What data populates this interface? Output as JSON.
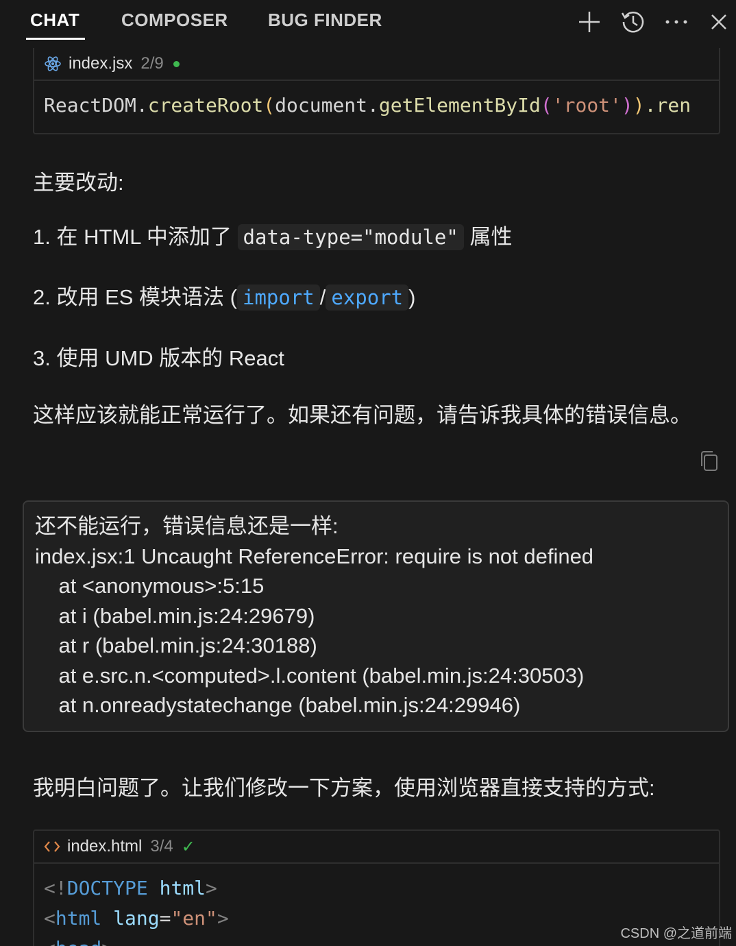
{
  "tabs": [
    {
      "label": "CHAT",
      "active": true
    },
    {
      "label": "COMPOSER",
      "active": false
    },
    {
      "label": "BUG FINDER",
      "active": false
    }
  ],
  "toolbar": {
    "icons": [
      "plus-icon",
      "history-icon",
      "more-icon",
      "close-icon"
    ]
  },
  "codeblock1": {
    "filename": "index.jsx",
    "count": "2/9",
    "status_dot_color": "#3fb950",
    "line": {
      "t1": "ReactDOM.",
      "t2": "createRoot",
      "t3": "(",
      "t4": "document.",
      "t5": "getElementById",
      "t6": "(",
      "t7": "'root'",
      "t8": ")",
      "t9": ")",
      "t10": ".ren"
    }
  },
  "assistant1": {
    "heading": "主要改动:",
    "item1_prefix": "1. 在 HTML 中添加了 ",
    "item1_code": "data-type=\"module\"",
    "item1_suffix": " 属性",
    "item2_prefix": "2. 改用 ES 模块语法 (",
    "item2_code1": "import",
    "item2_sep": "/",
    "item2_code2": "export",
    "item2_suffix": ")",
    "item3": "3. 使用 UMD 版本的 React",
    "closing": "这样应该就能正常运行了。如果还有问题，请告诉我具体的错误信息。"
  },
  "user_message": {
    "lines": [
      "还不能运行，错误信息还是一样:",
      "index.jsx:1 Uncaught ReferenceError: require is not defined",
      "    at <anonymous>:5:15",
      "    at i (babel.min.js:24:29679)",
      "    at r (babel.min.js:24:30188)",
      "    at e.src.n.<computed>.l.content (babel.min.js:24:30503)",
      "    at n.onreadystatechange (babel.min.js:24:29946)"
    ]
  },
  "assistant2": {
    "text": "我明白问题了。让我们修改一下方案，使用浏览器直接支持的方式:"
  },
  "codeblock2": {
    "filename": "index.html",
    "count": "3/4",
    "check": "✓",
    "line1": {
      "a": "<!",
      "b": "DOCTYPE",
      "c": " html",
      "d": ">"
    },
    "line2": {
      "a": "<",
      "b": "html",
      "c": " lang",
      "d": "=",
      "e": "\"en\"",
      "f": ">"
    },
    "line3": {
      "a": "<",
      "b": "head",
      "c": ">"
    }
  },
  "watermark": "CSDN @之道前端"
}
